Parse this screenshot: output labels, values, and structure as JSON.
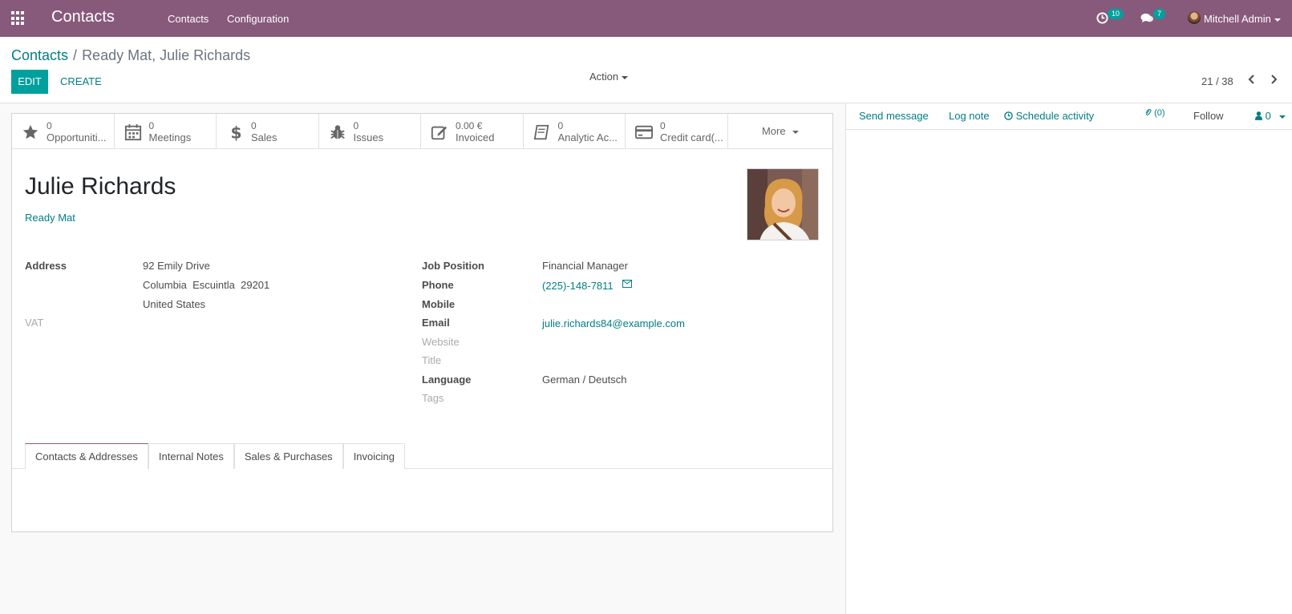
{
  "navbar": {
    "app_title": "Contacts",
    "menu": [
      "Contacts",
      "Configuration"
    ],
    "activity_count": "10",
    "message_count": "7",
    "user_name": "Mitchell Admin"
  },
  "breadcrumb": {
    "parent": "Contacts",
    "separator": "/",
    "current": "Ready Mat, Julie Richards"
  },
  "toolbar": {
    "edit_label": "EDIT",
    "create_label": "CREATE",
    "action_label": "Action",
    "pager": "21 / 38"
  },
  "stats": [
    {
      "value": "0",
      "label": "Opportuniti...",
      "icon": "star-icon"
    },
    {
      "value": "0",
      "label": "Meetings",
      "icon": "calendar-icon"
    },
    {
      "value": "0",
      "label": "Sales",
      "icon": "dollar-icon"
    },
    {
      "value": "0",
      "label": "Issues",
      "icon": "bug-icon"
    },
    {
      "value": "0.00 €",
      "label": "Invoiced",
      "icon": "edit-icon"
    },
    {
      "value": "0",
      "label": "Analytic Ac...",
      "icon": "book-icon"
    },
    {
      "value": "0",
      "label": "Credit card(...",
      "icon": "credit-card-icon"
    }
  ],
  "more_label": "More",
  "contact": {
    "name": "Julie Richards",
    "company": "Ready Mat"
  },
  "left_fields": {
    "address_label": "Address",
    "street": "92 Emily Drive",
    "city_line": "Columbia  Escuintla  29201",
    "country": "United States",
    "vat_label": "VAT"
  },
  "right_fields": {
    "job_label": "Job Position",
    "job_value": "Financial Manager",
    "phone_label": "Phone",
    "phone_value": "(225)-148-7811",
    "mobile_label": "Mobile",
    "email_label": "Email",
    "email_value": "julie.richards84@example.com",
    "website_label": "Website",
    "title_label": "Title",
    "language_label": "Language",
    "language_value": "German / Deutsch",
    "tags_label": "Tags"
  },
  "tabs": [
    "Contacts & Addresses",
    "Internal Notes",
    "Sales & Purchases",
    "Invoicing"
  ],
  "chatter": {
    "send_message": "Send message",
    "log_note": "Log note",
    "schedule_activity": "Schedule activity",
    "attachments": "(0)",
    "follow": "Follow",
    "followers": "0"
  },
  "colors": {
    "navbar": "#875a7b",
    "accent": "#00a09d",
    "link": "#017e84"
  }
}
